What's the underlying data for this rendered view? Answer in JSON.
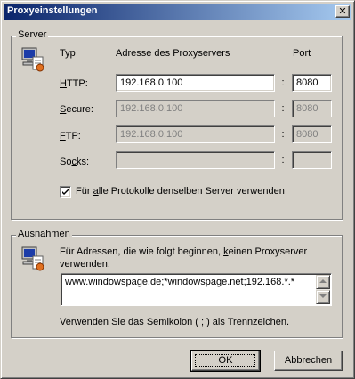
{
  "window": {
    "title": "Proxyeinstellungen",
    "close_glyph": "✕"
  },
  "server": {
    "legend": "Server",
    "col_type": "Typ",
    "col_address": "Adresse des Proxyservers",
    "col_port": "Port",
    "colon": ":",
    "rows": [
      {
        "accel": "H",
        "rest": "TTP:",
        "address": "192.168.0.100",
        "port": "8080",
        "enabled": true
      },
      {
        "accel": "S",
        "rest": "ecure:",
        "address": "192.168.0.100",
        "port": "8080",
        "enabled": false
      },
      {
        "accel": "F",
        "rest": "TP:",
        "address": "192.168.0.100",
        "port": "8080",
        "enabled": false
      },
      {
        "pre": "So",
        "accel": "c",
        "rest": "ks:",
        "address": "",
        "port": "",
        "enabled": false
      }
    ],
    "same_server": {
      "pre": "Für ",
      "accel": "a",
      "rest": "lle Protokolle denselben Server verwenden",
      "checked": true
    }
  },
  "exceptions": {
    "legend": "Ausnahmen",
    "desc_line1_pre": "Für Adressen, die wie folgt beginnen, ",
    "desc_line1_accel": "k",
    "desc_line1_rest": "einen Proxyserver",
    "desc_line2": "verwenden:",
    "value": "www.windowspage.de;*windowspage.net;192.168.*.*",
    "hint": "Verwenden Sie das Semikolon ( ; ) als Trennzeichen."
  },
  "buttons": {
    "ok": "OK",
    "cancel": "Abbrechen"
  },
  "icons": {
    "server": "network-computer-icon",
    "exceptions": "network-computer-icon"
  },
  "colors": {
    "face": "#d4d0c8",
    "title_start": "#0a246a",
    "title_end": "#a6caf0",
    "disabled_text": "#808080"
  }
}
